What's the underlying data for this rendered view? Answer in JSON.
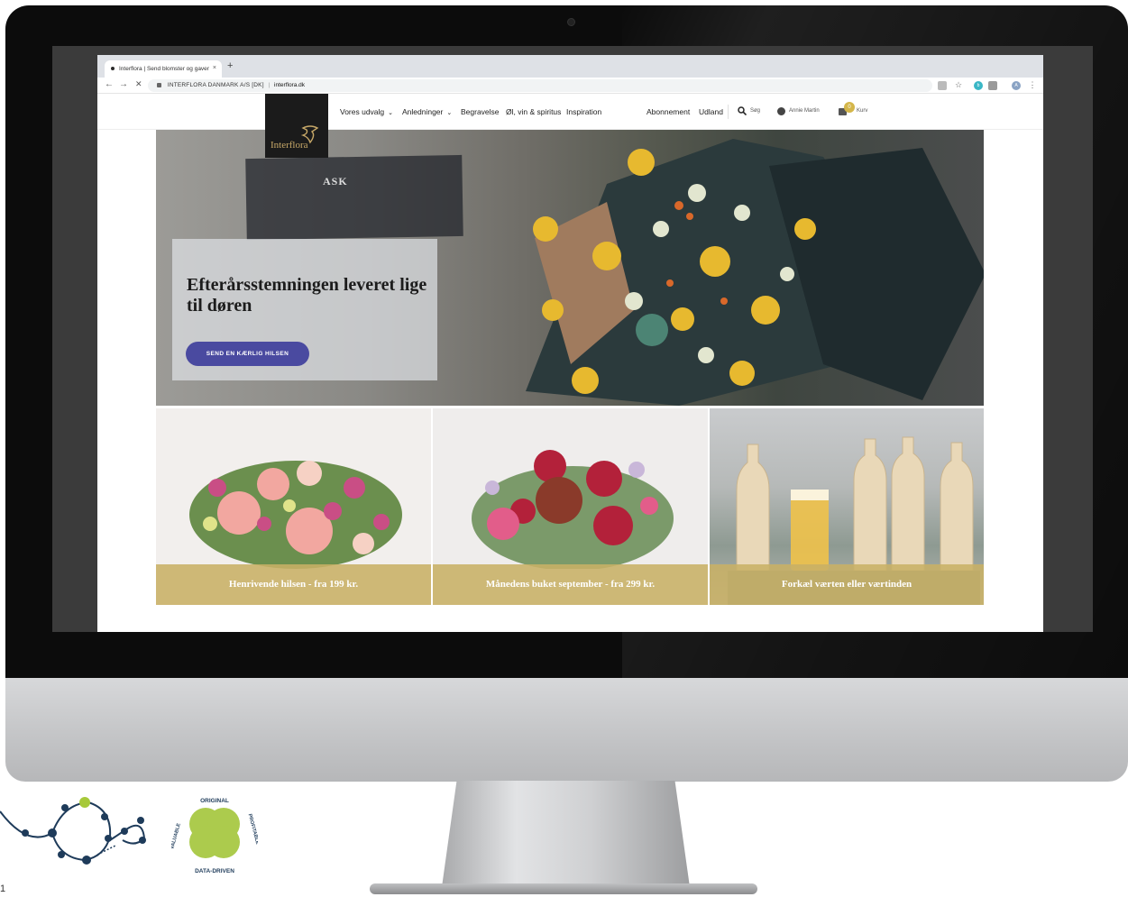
{
  "browser": {
    "tab_title": "Interflora | Send blomster og gaver",
    "new_tab": "+",
    "tab_close": "×",
    "back": "←",
    "forward": "→",
    "reload": "✕",
    "url_org": "INTERFLORA DANMARK A/S [DK]",
    "url_sep": "|",
    "url_host": "interflora.dk",
    "ext_1": "b",
    "ext_2": "A"
  },
  "site": {
    "logo_text": "Interflora",
    "nav": {
      "vores_udvalg": "Vores udvalg",
      "anledninger": "Anledninger",
      "begravelse": "Begravelse",
      "ol_vin": "Øl, vin & spiritus",
      "inspiration": "Inspiration",
      "abonnement": "Abonnement",
      "udland": "Udland",
      "sog": "Søg",
      "user": "Annie Martin",
      "cart_count": "0",
      "cart": "Kurv"
    },
    "hero": {
      "title": "Efterårsstemningen leveret lige til døren",
      "cta": "SEND EN KÆRLIG HILSEN",
      "sign_text": "ASK"
    },
    "tiles": [
      {
        "caption": "Henrivende hilsen - fra 199 kr."
      },
      {
        "caption": "Månedens buket september - fra 299 kr."
      },
      {
        "caption": "Forkæl værten eller værtinden"
      }
    ]
  },
  "badge": {
    "top": "ORIGINAL",
    "left": "VALUABLE",
    "right": "PROFITABLE",
    "bottom": "DATA-DRIVEN"
  },
  "page_number": "1",
  "colors": {
    "accent_gold": "#c8b065",
    "cta_purple": "#4a4aa0",
    "logo_bg": "#1b1b1b"
  }
}
